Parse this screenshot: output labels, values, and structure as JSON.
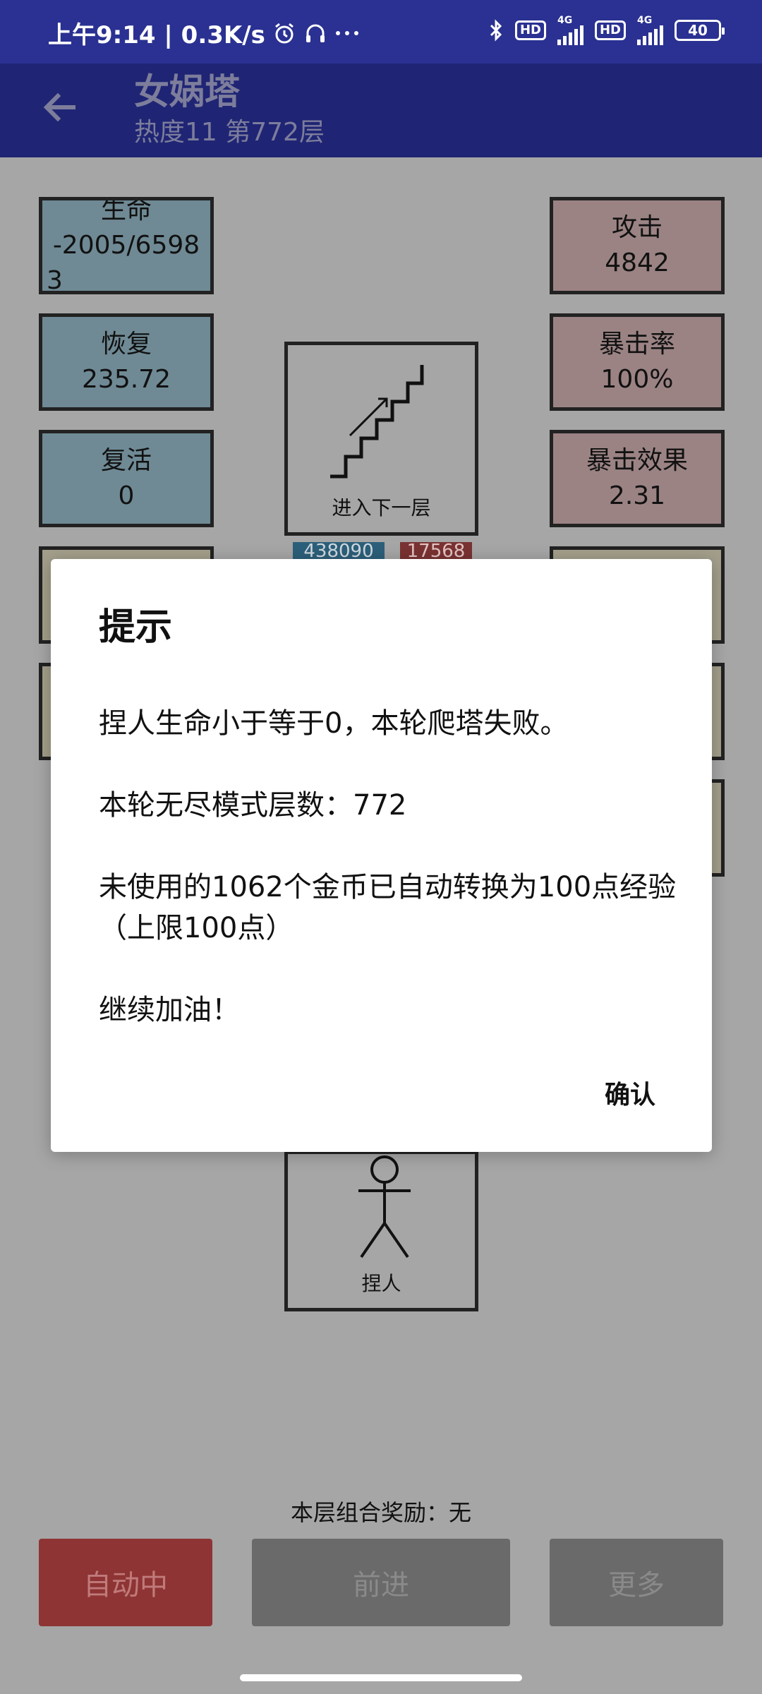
{
  "status_bar": {
    "time_speed": "上午9:14 | 0.3K/s",
    "network_1": "4G",
    "network_2": "4G",
    "hd_1": "HD",
    "hd_2": "HD",
    "battery": "40"
  },
  "app_bar": {
    "title": "女娲塔",
    "subtitle": "热度11 第772层"
  },
  "stats_left": [
    {
      "label": "生命",
      "value": "-2005/6598",
      "value_extra": "3"
    },
    {
      "label": "恢复",
      "value": "235.72"
    },
    {
      "label": "复活",
      "value": "0"
    }
  ],
  "stats_right": [
    {
      "label": "攻击",
      "value": "4842"
    },
    {
      "label": "暴击率",
      "value": "100%"
    },
    {
      "label": "暴击效果",
      "value": "2.31"
    }
  ],
  "tower": {
    "next_floor_label": "进入下一层",
    "mini_blue_value": "438090",
    "mini_red_value": "17568",
    "player_label": "捏人"
  },
  "bonus_text": "本层组合奖励：无",
  "buttons": {
    "auto": "自动中",
    "forward": "前进",
    "more": "更多"
  },
  "dialog": {
    "title": "提示",
    "line1": "捏人生命小于等于0，本轮爬塔失败。",
    "line2": "本轮无尽模式层数：772",
    "line3": "未使用的1062个金币已自动转换为100点经验（上限100点）",
    "line4": "继续加油！",
    "confirm": "确认"
  },
  "colors": {
    "status_bar": "#2a3192",
    "app_bar": "#1f2574",
    "overlay_bg": "#a6a6a6",
    "stat_blue": "#6f8a95",
    "stat_pink": "#9b8384",
    "stat_tan": "#a39f8b",
    "auto_button": "#8e3434"
  }
}
